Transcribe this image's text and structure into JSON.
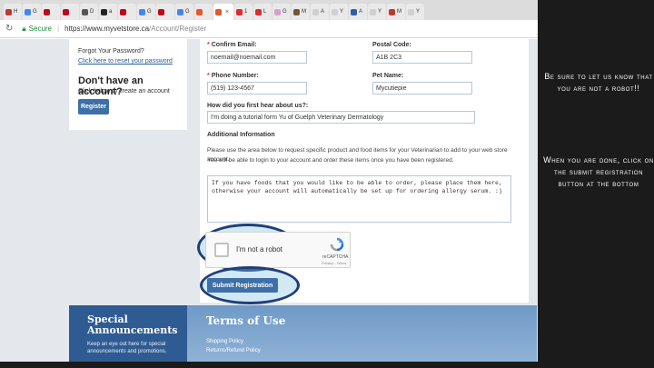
{
  "browser": {
    "tabs": [
      {
        "label": "H",
        "color": "#c0392b"
      },
      {
        "label": "G",
        "color": "#4285f4"
      },
      {
        "label": "",
        "color": "#bd081c"
      },
      {
        "label": "",
        "color": "#bd081c"
      },
      {
        "label": "D",
        "color": "#555555"
      },
      {
        "label": "a",
        "color": "#222222"
      },
      {
        "label": "",
        "color": "#bd081c"
      },
      {
        "label": "G",
        "color": "#4285f4"
      },
      {
        "label": "",
        "color": "#bd081c"
      },
      {
        "label": "G",
        "color": "#4285f4"
      },
      {
        "label": "",
        "color": "#e05a2b"
      },
      {
        "label": "1",
        "color": "#e02b2b"
      },
      {
        "label": "L",
        "color": "#e02b2b"
      },
      {
        "label": "G",
        "color": "#d6a0c8"
      },
      {
        "label": "M",
        "color": "#6f5a3a"
      },
      {
        "label": "A",
        "color": "#d0d0d0"
      },
      {
        "label": "Y",
        "color": "#d0d0d0"
      },
      {
        "label": "A",
        "color": "#2b5fa8"
      },
      {
        "label": "Y",
        "color": "#d0d0d0"
      },
      {
        "label": "M",
        "color": "#c0392b"
      },
      {
        "label": "Y",
        "color": "#d0d0d0"
      }
    ],
    "active_tab": {
      "label": "",
      "color": "#e05a2b"
    },
    "secure_label": "Secure",
    "url_host": "https://www.myvetstore.ca",
    "url_path": "/Account/Register"
  },
  "left_card": {
    "forgot_title": "Forgot Your Password?",
    "forgot_link": "Click here to reset your password",
    "no_account_title": "Don't have an account?",
    "no_account_sub": "Click below to create an account",
    "register_button": "Register"
  },
  "form": {
    "required_mark": "*",
    "confirm_email_label": "Confirm Email:",
    "confirm_email_value": "noemail@noemail.com",
    "postal_code_label": "Postal Code:",
    "postal_code_value": "A1B 2C3",
    "phone_label": "Phone Number:",
    "phone_value": "(519) 123-4567",
    "pet_name_label": "Pet Name:",
    "pet_name_value": "Mycutiepie",
    "heard_label": "How did you first hear about us?:",
    "heard_value": "I'm doing a tutorial form Yu of Guelph Veterinary Dermatology",
    "additional_title": "Additional Information",
    "additional_para_1": "Please use the area below to request specific product and food items for your Veterinarian to add to your web store account.",
    "additional_para_2": "You will be able to login to your account and order these items once you have been registered.",
    "textarea_line_1": "If you have foods that you would like to be able to order, please place them here,",
    "textarea_line_2": "otherwise your account will automatically be set up for ordering allergy serum. :)",
    "captcha_label": "I'm not a robot",
    "captcha_brand": "reCAPTCHA",
    "captcha_privacy": "Privacy - Terms",
    "submit_button": "Submit Registration"
  },
  "footer": {
    "announcements_title": "Special Announcements",
    "announcements_text": "Keep an eye out here for special announcements and promotions.",
    "terms_title": "Terms of Use",
    "link_shipping": "Shipping Policy",
    "link_returns": "Returns/Refund Policy"
  },
  "caption": {
    "line_1": "Be sure to let us know that you are not a robot!!",
    "line_2": "When you are done, click on the submit registration button at the bottom"
  },
  "colors": {
    "highlight_oval_border": "#1f3f78",
    "button_blue": "#3e6fa8"
  }
}
